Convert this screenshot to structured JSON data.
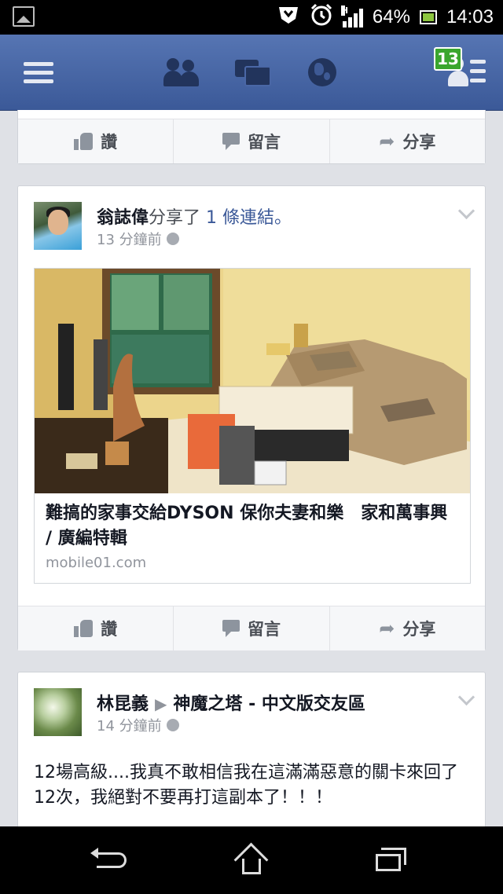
{
  "status_bar": {
    "icons": [
      "gallery-icon",
      "download-icon",
      "alarm-clock-icon",
      "signal-icon",
      "battery-icon"
    ],
    "network_type": "H",
    "battery": "64%",
    "time": "14:03"
  },
  "nav": {
    "icons": [
      "menu-icon",
      "friends-icon",
      "messages-icon",
      "notifications-globe-icon",
      "friend-requests-icon"
    ],
    "friend_request_count": "13",
    "accent": "#3b5998",
    "badge_color": "#3aa62e"
  },
  "actions": {
    "like": "讚",
    "comment": "留言",
    "share": "分享"
  },
  "posts": [
    {
      "author": "翁誌偉",
      "verb": "分享了",
      "object": "1 條連結。",
      "time": "13 分鐘前",
      "link": {
        "title": "難搞的家事交給DYSON 保你夫妻和樂　家和萬事興 / 廣編特輯",
        "domain": "mobile01.com"
      }
    },
    {
      "author": "林昆義",
      "group": "神魔之塔 - 中文版交友區",
      "time": "14 分鐘前",
      "text": "12場高級....我真不敢相信我在這滿滿惡意的關卡來回了12次，我絕對不要再打這副本了！！！"
    }
  ],
  "bottom_nav": {
    "icons": [
      "back-icon",
      "home-icon",
      "recent-apps-icon"
    ]
  }
}
